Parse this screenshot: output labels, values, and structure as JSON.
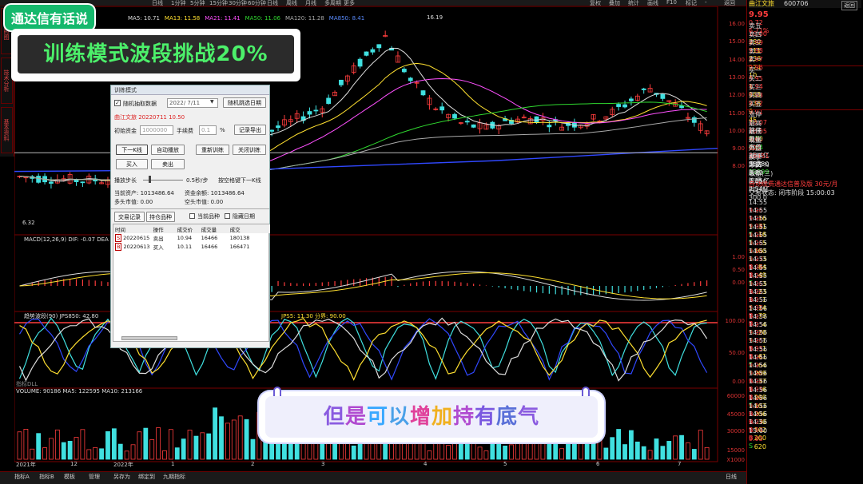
{
  "window_title": "曲江文旅 600706",
  "toolbar": {
    "items": [
      "日线",
      "1分钟",
      "5分钟",
      "15分钟",
      "30分钟",
      "60分钟",
      "日线",
      "周线",
      "月线",
      "多周期",
      "更多"
    ],
    "right_items": [
      "复权",
      "叠加",
      "统计",
      "画线",
      "F10",
      "标记",
      "-",
      "返回"
    ]
  },
  "left_tabs": [
    "分时图",
    "技术分析",
    "基本资料"
  ],
  "overlay": {
    "badge": "通达信有话说",
    "banner": "训练模式波段挑战20%",
    "subtitle_chars": [
      "但",
      "是",
      "可",
      "以",
      "增",
      "加",
      "持",
      "有",
      "底",
      "气"
    ]
  },
  "main_chart": {
    "ma_legend": [
      {
        "text": "MA5: 10.71",
        "color": "#dddddd"
      },
      {
        "text": "MA13: 11.58",
        "color": "#ffe030"
      },
      {
        "text": "MA21: 11.41",
        "color": "#ff50ff"
      },
      {
        "text": "MA50: 11.06",
        "color": "#2fd82f"
      },
      {
        "text": "MA120: 11.28",
        "color": "#aaaaaa"
      },
      {
        "text": "MA850: 8.41",
        "color": "#5a8cff"
      }
    ],
    "peak_label": "16.19",
    "low_label": "6.32",
    "y_ticks": [
      "16.00",
      "15.00",
      "14.00",
      "13.00",
      "12.00",
      "11.00",
      "10.00",
      "9.00",
      "8.00"
    ]
  },
  "macd": {
    "legend": "MACD(12,26,9)  DIF: -0.07  DEA",
    "y_ticks": [
      "1.00",
      "0.50",
      "0.00"
    ]
  },
  "trend": {
    "legend_left": "趋势波段(90)  JPS850: 42.80",
    "legend_right": "JPS5: 11.30  分界: 90.00",
    "y_ticks": [
      "100.00",
      "50.00",
      "0.00"
    ],
    "bottom_label": "指标DLL"
  },
  "volume": {
    "legend": "VOLUME: 90186  MA5: 122595  MA10: 213166",
    "y_ticks": [
      "60000",
      "45000",
      "30000",
      "15000",
      "X1000"
    ]
  },
  "x_axis": {
    "labels": [
      "2021年",
      "12",
      "2022年",
      "1",
      "2",
      "3",
      "4",
      "5",
      "6",
      "7"
    ]
  },
  "dialog": {
    "title": "训练模式",
    "checkbox_label": "随机抽取数据",
    "date_value": "2022/ 7/11",
    "random_button": "随机跳选日期",
    "stock_info": "曲江文旅  20220711  10.50",
    "capital_label": "初始资金",
    "capital_value": "1000000",
    "fee_label": "手续费",
    "fee_value": "0.1",
    "fee_unit": "%",
    "export_button": "记录导出",
    "next_button": "下一K线",
    "autoplay_button": "自动播放",
    "restart_button": "重新训练",
    "close_button": "关闭训练",
    "buy_button": "买入",
    "sell_button": "卖出",
    "speed_label": "播放步长",
    "speed_value": "0.5秒/步",
    "space_hint": "按空格键下一K线",
    "assets_label": "当前资产:  1013486.64",
    "balance_label": "资金余额:  1013486.64",
    "long_label": "多头市值:  0.00",
    "short_label": "空头市值:  0.00",
    "tabs": [
      "交易记录",
      "持仓品种"
    ],
    "options": [
      "当前品种",
      "隐藏日期"
    ],
    "columns": [
      "时间",
      "操作",
      "成交价",
      "成交量",
      "成交"
    ],
    "rows": [
      {
        "flag": "S",
        "date": "20220615",
        "op": "卖出",
        "price": "10.94",
        "vol": "16466",
        "amt": "180138"
      },
      {
        "flag": "B",
        "date": "20220613",
        "op": "买入",
        "price": "10.11",
        "vol": "16466",
        "amt": "166471"
      }
    ]
  },
  "quote_panel": {
    "name": "曲江文旅",
    "code": "600706",
    "price": "9.95",
    "change": "0.72",
    "pct": "6.71%",
    "asks": [
      {
        "label": "卖五",
        "price": "10.00",
        "vol": "380"
      },
      {
        "label": "卖四",
        "price": "9.99",
        "vol": "311"
      },
      {
        "label": "卖三",
        "price": "9.98",
        "vol": "236"
      },
      {
        "label": "卖二",
        "price": "9.97",
        "vol": "224"
      },
      {
        "label": "卖一",
        "price": "9.96",
        "vol": "10"
      }
    ],
    "bids": [
      {
        "label": "买一",
        "price": "9.95",
        "vol": "1"
      },
      {
        "label": "买二",
        "price": "9.94",
        "vol": "963"
      },
      {
        "label": "买三",
        "price": "9.93",
        "vol": "236"
      },
      {
        "label": "买四",
        "price": "9.92",
        "vol": "9"
      },
      {
        "label": "买五",
        "price": "9.91",
        "vol": "45"
      }
    ],
    "stats": [
      {
        "l1": "涨停",
        "v1": "10.07",
        "c1": "red",
        "l2": "跌停",
        "v2": "8.89",
        "c2": "green"
      },
      {
        "l1": "最高",
        "v1": "10.05",
        "c1": "red",
        "l2": "量比",
        "v2": "0.64",
        "c2": "green"
      },
      {
        "l1": "最低",
        "v1": "9.60",
        "c1": "red",
        "l2": "市值",
        "v2": "25.4亿",
        "c2": "white"
      },
      {
        "l1": "现量",
        "v1": "620",
        "c1": "red",
        "l2": "总量",
        "v2": "55750",
        "c2": "white"
      },
      {
        "l1": "外盘",
        "v1": "26451",
        "c1": "red",
        "l2": "内盘",
        "v2": "29299",
        "c2": "green"
      },
      {
        "l1": "换手",
        "v1": "2.19%",
        "c1": "white",
        "l2": "股本",
        "v2": "2.55亿",
        "c2": "white"
      },
      {
        "l1": "净资",
        "v1": "3.82",
        "c1": "white",
        "l2": "流通",
        "v2": "2.54亿",
        "c2": "white"
      },
      {
        "l1": "收益(三)",
        "v1": "0.010",
        "c1": "white",
        "l2": "PE(动)",
        "v2": "300.0",
        "c2": "white"
      }
    ],
    "notice": "自动续费通达信普及版  30元/月",
    "status": "交易状态: 闭市阶段  15:00:03",
    "ticks": [
      {
        "t": "14:55",
        "p": "9.96",
        "v": "16",
        "d": "S"
      },
      {
        "t": "14:55",
        "p": "9.96",
        "v": "31",
        "d": "S"
      },
      {
        "t": "14:55",
        "p": "9.96",
        "v": "16",
        "d": "S"
      },
      {
        "t": "14:55",
        "p": "9.96",
        "v": "5",
        "d": "S"
      },
      {
        "t": "14:55",
        "p": "9.96",
        "v": "100",
        "d": "S"
      },
      {
        "t": "14:55",
        "p": "9.96",
        "v": "3",
        "d": "B"
      },
      {
        "t": "14:55",
        "p": "9.97",
        "v": "84",
        "d": "B"
      },
      {
        "t": "14:55",
        "p": "9.96",
        "v": "49",
        "d": "S"
      },
      {
        "t": "14:55",
        "p": "9.96",
        "v": "3",
        "d": "B"
      },
      {
        "t": "14:55",
        "p": "9.96",
        "v": "23",
        "d": "B"
      },
      {
        "t": "14:55",
        "p": "9.96",
        "v": "1",
        "d": "S"
      },
      {
        "t": "14:55",
        "p": "9.95",
        "v": "14",
        "d": "B"
      },
      {
        "t": "14:56",
        "p": "9.96",
        "v": "79",
        "d": "B"
      },
      {
        "t": "14:56",
        "p": "9.95",
        "v": "4",
        "d": "S"
      },
      {
        "t": "14:56",
        "p": "9.95",
        "v": "20",
        "d": "S"
      },
      {
        "t": "14:56",
        "p": "9.96",
        "v": "1",
        "d": "B"
      },
      {
        "t": "14:56",
        "p": "9.96",
        "v": "1",
        "d": "B"
      },
      {
        "t": "14:56",
        "p": "9.95",
        "v": "61",
        "d": "S"
      },
      {
        "t": "14:56",
        "p": "9.96",
        "v": "64",
        "d": "S"
      },
      {
        "t": "14:56",
        "p": "9.95",
        "v": "209",
        "d": "B"
      },
      {
        "t": "14:56",
        "p": "9.96",
        "v": "37",
        "d": "B"
      },
      {
        "t": "14:56",
        "p": "9.96",
        "v": "6",
        "d": "B"
      },
      {
        "t": "14:56",
        "p": "9.95",
        "v": "200",
        "d": "S"
      },
      {
        "t": "14:56",
        "p": "9.96",
        "v": "103",
        "d": "B"
      },
      {
        "t": "14:56",
        "p": "9.95",
        "v": "206",
        "d": "B"
      },
      {
        "t": "14:56",
        "p": "9.95",
        "v": "30",
        "d": "B"
      },
      {
        "t": "14:56",
        "p": "9.97",
        "v": "102",
        "d": "B"
      },
      {
        "t": "14:56",
        "p": "9.94",
        "v": "200",
        "d": "S"
      },
      {
        "t": "15:00",
        "p": "9.95",
        "v": "620",
        "d": ""
      }
    ]
  },
  "bottom_bar": {
    "items": [
      "指标A",
      "指标B",
      "模板",
      "管理",
      "另存为",
      "绑定到",
      "九期指标"
    ],
    "right": "日线"
  }
}
